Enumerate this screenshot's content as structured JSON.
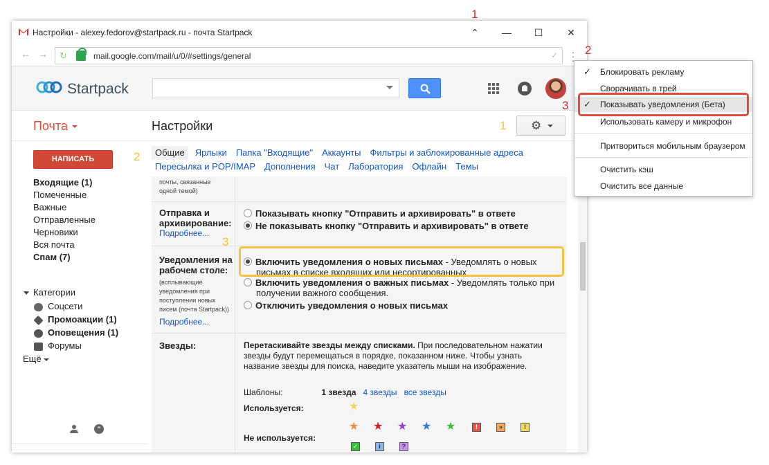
{
  "window": {
    "title": "Настройки - alexey.fedorov@startpack.ru - почта Startpack",
    "url": "mail.google.com/mail/u/0/#settings/general"
  },
  "header": {
    "logo_text": "Startpack",
    "search_placeholder": ""
  },
  "subheader": {
    "mail_label": "Почта",
    "page_title": "Настройки"
  },
  "sidebar": {
    "compose_label": "НАПИСАТЬ",
    "items": [
      {
        "label": "Входящие (1)",
        "bold": true
      },
      {
        "label": "Помеченные",
        "bold": false
      },
      {
        "label": "Важные",
        "bold": false
      },
      {
        "label": "Отправленные",
        "bold": false
      },
      {
        "label": "Черновики",
        "bold": false
      },
      {
        "label": "Вся почта",
        "bold": false
      },
      {
        "label": "Спам (7)",
        "bold": true
      }
    ],
    "categories_label": "Категории",
    "categories": [
      {
        "label": "Соцсети",
        "bold": false,
        "icon": "people-icon"
      },
      {
        "label": "Промоакции (1)",
        "bold": true,
        "icon": "tag-icon"
      },
      {
        "label": "Оповещения (1)",
        "bold": true,
        "icon": "info-icon"
      },
      {
        "label": "Форумы",
        "bold": false,
        "icon": "forum-icon"
      }
    ],
    "more_label": "Ещё"
  },
  "tabs": {
    "row1": [
      "Общие",
      "Ярлыки",
      "Папка \"Входящие\"",
      "Аккаунты",
      "Фильтры и заблокированные адреса"
    ],
    "row2": [
      "Пересылка и POP/IMAP",
      "Дополнения",
      "Чат",
      "Лаборатория",
      "Офлайн",
      "Темы"
    ]
  },
  "settings": {
    "partial_note": "почты, связанные одной темой)",
    "send_archive": {
      "label": "Отправка и архивирование:",
      "more": "Подробнее...",
      "opt1": "Показывать кнопку \"Отправить и архивировать\" в ответе",
      "opt2": "Не показывать кнопку \"Отправить и архивировать\" в ответе"
    },
    "desktop": {
      "label": "Уведомления на рабочем столе:",
      "note": "(всплывающие уведомления при поступлении новых писем (почта Startpack))",
      "more": "Подробнее...",
      "opt1_bold": "Включить уведомления о новых письмах",
      "opt1_rest": " - Уведомлять о новых",
      "opt1_line2": "письмах в списке входящих или несортированных",
      "opt2_bold": "Включить уведомления о важных письмах",
      "opt2_rest": " - Уведомлять только при",
      "opt2_line2": "получении важного сообщения.",
      "opt3_bold": "Отключить уведомления о новых письмах"
    },
    "stars": {
      "label": "Звезды:",
      "text_bold": "Перетаскивайте звезды между списками.",
      "text_rest": " При последовательном нажатии звезды будут перемещаться в порядке, показанном ниже. Чтобы узнать название звезды для поиска, наведите указатель мыши на изображение.",
      "templates_label": "Шаблоны:",
      "t1": "1 звезда",
      "t4": "4 звезды",
      "tall": "все звезды",
      "used_label": "Используется:",
      "unused_label": "Не используется:"
    }
  },
  "dropdown": {
    "items": [
      {
        "label": "Блокировать рекламу",
        "checked": true
      },
      {
        "label": "Сворачивать в трей",
        "checked": false
      },
      {
        "label": "Показывать уведомления (Бета)",
        "checked": true
      },
      {
        "label": "Использовать камеру и микрофон",
        "checked": false
      },
      {
        "label": "Притвориться мобильным браузером",
        "checked": false
      },
      {
        "label": "Очистить кэш",
        "checked": false
      },
      {
        "label": "Очистить все данные",
        "checked": false
      }
    ]
  },
  "annotations": {
    "red1": "1",
    "red2": "2",
    "red3": "3",
    "yel1": "1",
    "yel2": "2",
    "yel3": "3"
  },
  "colors": {
    "accent_red": "#dd4b39",
    "link_blue": "#1155cc",
    "annotation_red": "#e04b3f",
    "annotation_yellow": "#f5c542"
  }
}
